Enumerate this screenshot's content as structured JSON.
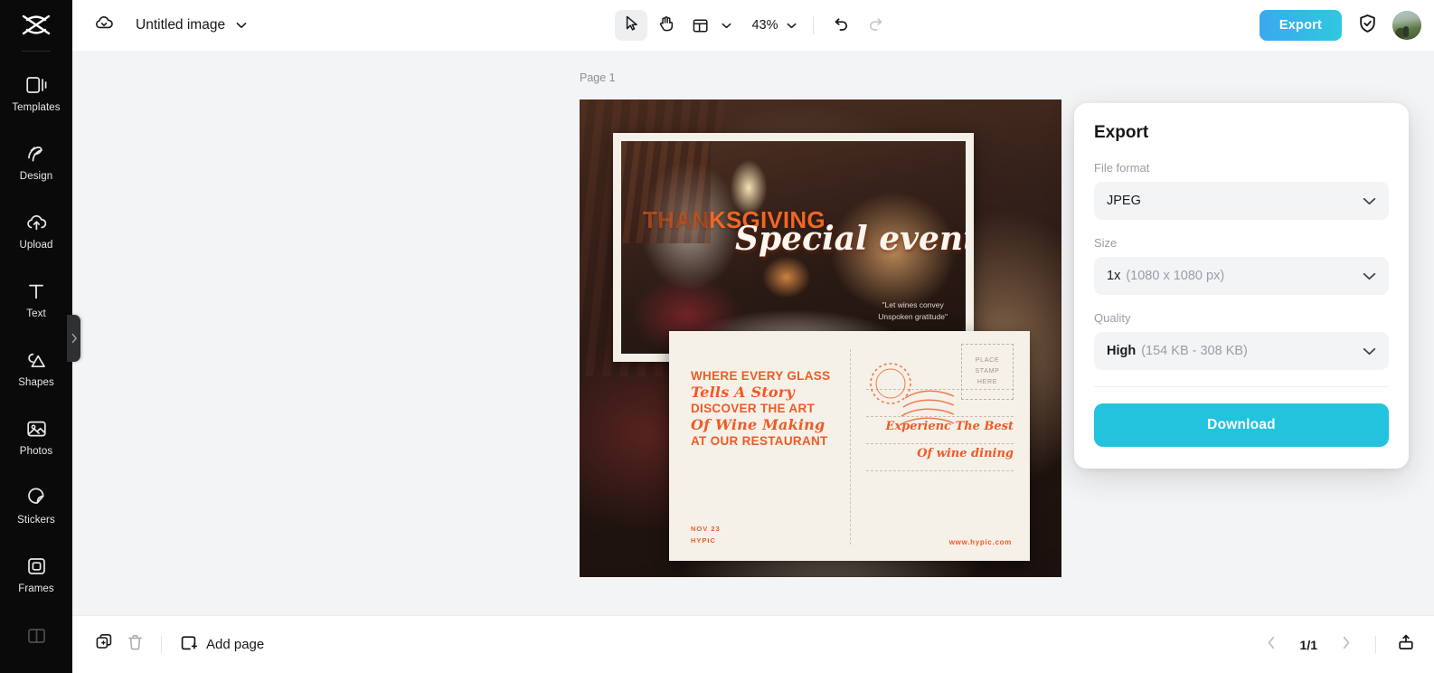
{
  "sidebar": {
    "logo": "capcut-logo",
    "items": [
      {
        "label": "Templates",
        "icon": "templates-icon"
      },
      {
        "label": "Design",
        "icon": "design-icon"
      },
      {
        "label": "Upload",
        "icon": "upload-cloud-icon"
      },
      {
        "label": "Text",
        "icon": "text-icon"
      },
      {
        "label": "Shapes",
        "icon": "shapes-icon"
      },
      {
        "label": "Photos",
        "icon": "photos-icon"
      },
      {
        "label": "Stickers",
        "icon": "stickers-icon"
      },
      {
        "label": "Frames",
        "icon": "frames-icon"
      }
    ]
  },
  "topbar": {
    "cloud_icon": "cloud-sync-icon",
    "doc_title": "Untitled image",
    "title_chevron": "chevron-down-icon",
    "tools": [
      {
        "name": "select-tool",
        "icon": "cursor-arrow-icon",
        "active": true
      },
      {
        "name": "hand-tool",
        "icon": "hand-icon",
        "active": false
      },
      {
        "name": "layout-tool",
        "icon": "layout-icon",
        "active": false
      }
    ],
    "zoom_level": "43%",
    "undo_icon": "undo-arrow-icon",
    "redo_icon": "redo-arrow-icon",
    "export_label": "Export",
    "shield_icon": "shield-check-icon",
    "avatar": "user-avatar"
  },
  "canvas": {
    "page_label": "Page 1",
    "design": {
      "headline": "THANKSGIVING",
      "subhead": "Special event",
      "quote_line1": "\"Let wines convey",
      "quote_line2": "Unspoken gratitude\"",
      "postcard": {
        "body_lines": [
          {
            "text": "WHERE EVERY GLASS",
            "style": "caps"
          },
          {
            "text": "Tells A Story",
            "style": "script"
          },
          {
            "text": "DISCOVER THE ART",
            "style": "caps"
          },
          {
            "text": "Of Wine Making",
            "style": "script"
          },
          {
            "text": "AT OUR RESTAURANT",
            "style": "caps"
          }
        ],
        "hand_line1": "Experienc The Best",
        "hand_line2": "Of wine dining",
        "stamp_text": [
          "PLACE",
          "STAMP",
          "HERE"
        ],
        "footer_date": "NOV 23",
        "footer_brand": "HYPIC",
        "footer_url": "www.hypic.com"
      }
    }
  },
  "export_panel": {
    "title": "Export",
    "fields": [
      {
        "label": "File format",
        "value": "JPEG",
        "value_dim": ""
      },
      {
        "label": "Size",
        "value": "1x",
        "value_dim": "(1080 x 1080 px)"
      },
      {
        "label": "Quality",
        "value": "High",
        "value_dim": "(154 KB - 308 KB)"
      }
    ],
    "download_label": "Download",
    "chevron_icon": "chevron-down-icon"
  },
  "bottombar": {
    "duplicate_icon": "duplicate-page-icon",
    "delete_icon": "trash-icon",
    "add_page_label": "Add page",
    "add_page_icon": "plus-square-icon",
    "prev_icon": "chevron-left-icon",
    "next_icon": "chevron-right-icon",
    "page_count": "1/1",
    "export_icon": "upload-box-icon"
  },
  "colors": {
    "accent_cyan": "#24c3dd",
    "export_gradient_start": "#3ba8f0",
    "export_gradient_end": "#2fc8e0",
    "sidebar_bg": "#0a0a0b",
    "canvas_bg": "#f3f4f5",
    "design_orange": "#ef5a26"
  }
}
